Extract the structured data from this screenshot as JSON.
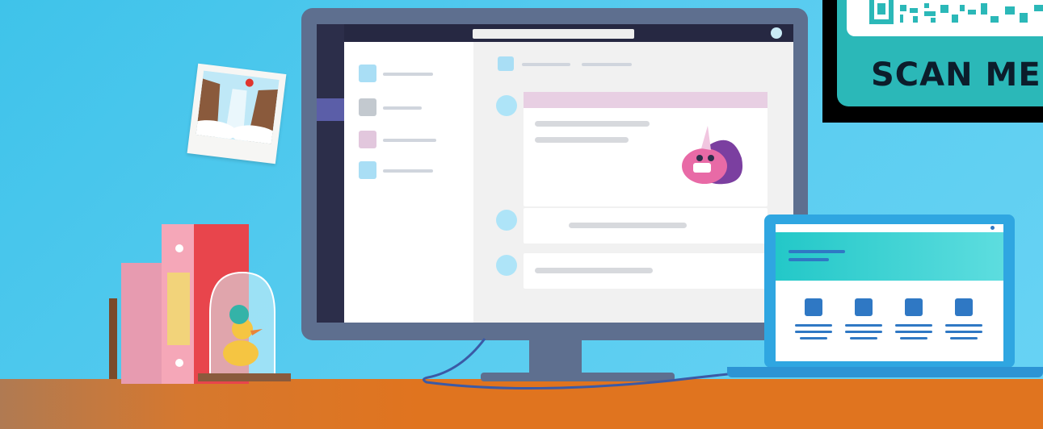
{
  "qr_badge": {
    "label": "SCAN ME"
  },
  "illustration": {
    "monitor_app": {
      "sidebar_items": 4,
      "messages": 3
    },
    "laptop_app": {
      "tiles": 4
    }
  },
  "colors": {
    "background": "#4fc7ee",
    "desk": "#e0741f",
    "monitor_frame": "#5e6f8f",
    "laptop_frame": "#2fa6e1",
    "qr_card": "#2bb8b8"
  }
}
